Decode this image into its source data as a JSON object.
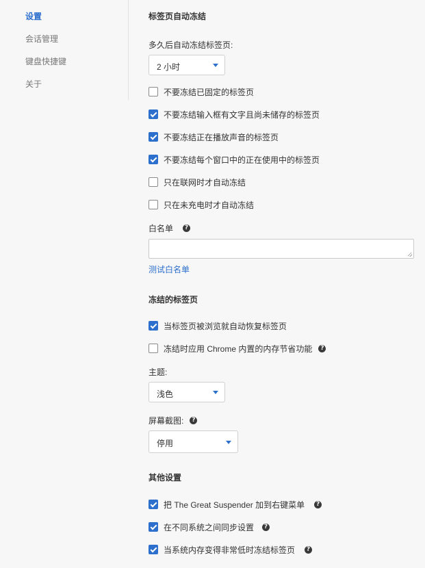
{
  "sidebar": {
    "items": [
      {
        "label": "设置"
      },
      {
        "label": "会话管理"
      },
      {
        "label": "键盘快捷键"
      },
      {
        "label": "关于"
      }
    ]
  },
  "auto_freeze": {
    "title": "标签页自动冻结",
    "delay_label": "多久后自动冻结标签页:",
    "delay_value": "2 小时",
    "options": [
      {
        "label": "不要冻结已固定的标签页",
        "checked": false
      },
      {
        "label": "不要冻结输入框有文字且尚未储存的标签页",
        "checked": true
      },
      {
        "label": "不要冻结正在播放声音的标签页",
        "checked": true
      },
      {
        "label": "不要冻结每个窗口中的正在使用中的标签页",
        "checked": true
      },
      {
        "label": "只在联网时才自动冻结",
        "checked": false
      },
      {
        "label": "只在未充电时才自动冻结",
        "checked": false
      }
    ],
    "whitelist_label": "白名单",
    "whitelist_value": "",
    "test_whitelist_link": "测试白名单"
  },
  "frozen_tabs": {
    "title": "冻结的标签页",
    "options": [
      {
        "label": "当标签页被浏览就自动恢复标签页",
        "checked": true
      },
      {
        "label": "冻结时应用 Chrome 内置的内存节省功能",
        "checked": false
      }
    ],
    "theme_label": "主题:",
    "theme_value": "浅色",
    "screenshot_label": "屏幕截图:",
    "screenshot_value": "停用"
  },
  "other": {
    "title": "其他设置",
    "options": [
      {
        "label": "把 The Great Suspender 加到右键菜单",
        "checked": true
      },
      {
        "label": "在不同系统之间同步设置",
        "checked": true
      },
      {
        "label": "当系统内存变得非常低时冻结标签页",
        "checked": true
      }
    ]
  },
  "icons": {
    "help": "?"
  },
  "colors": {
    "accent": "#2c6fcd",
    "background": "#f7f7f7"
  }
}
